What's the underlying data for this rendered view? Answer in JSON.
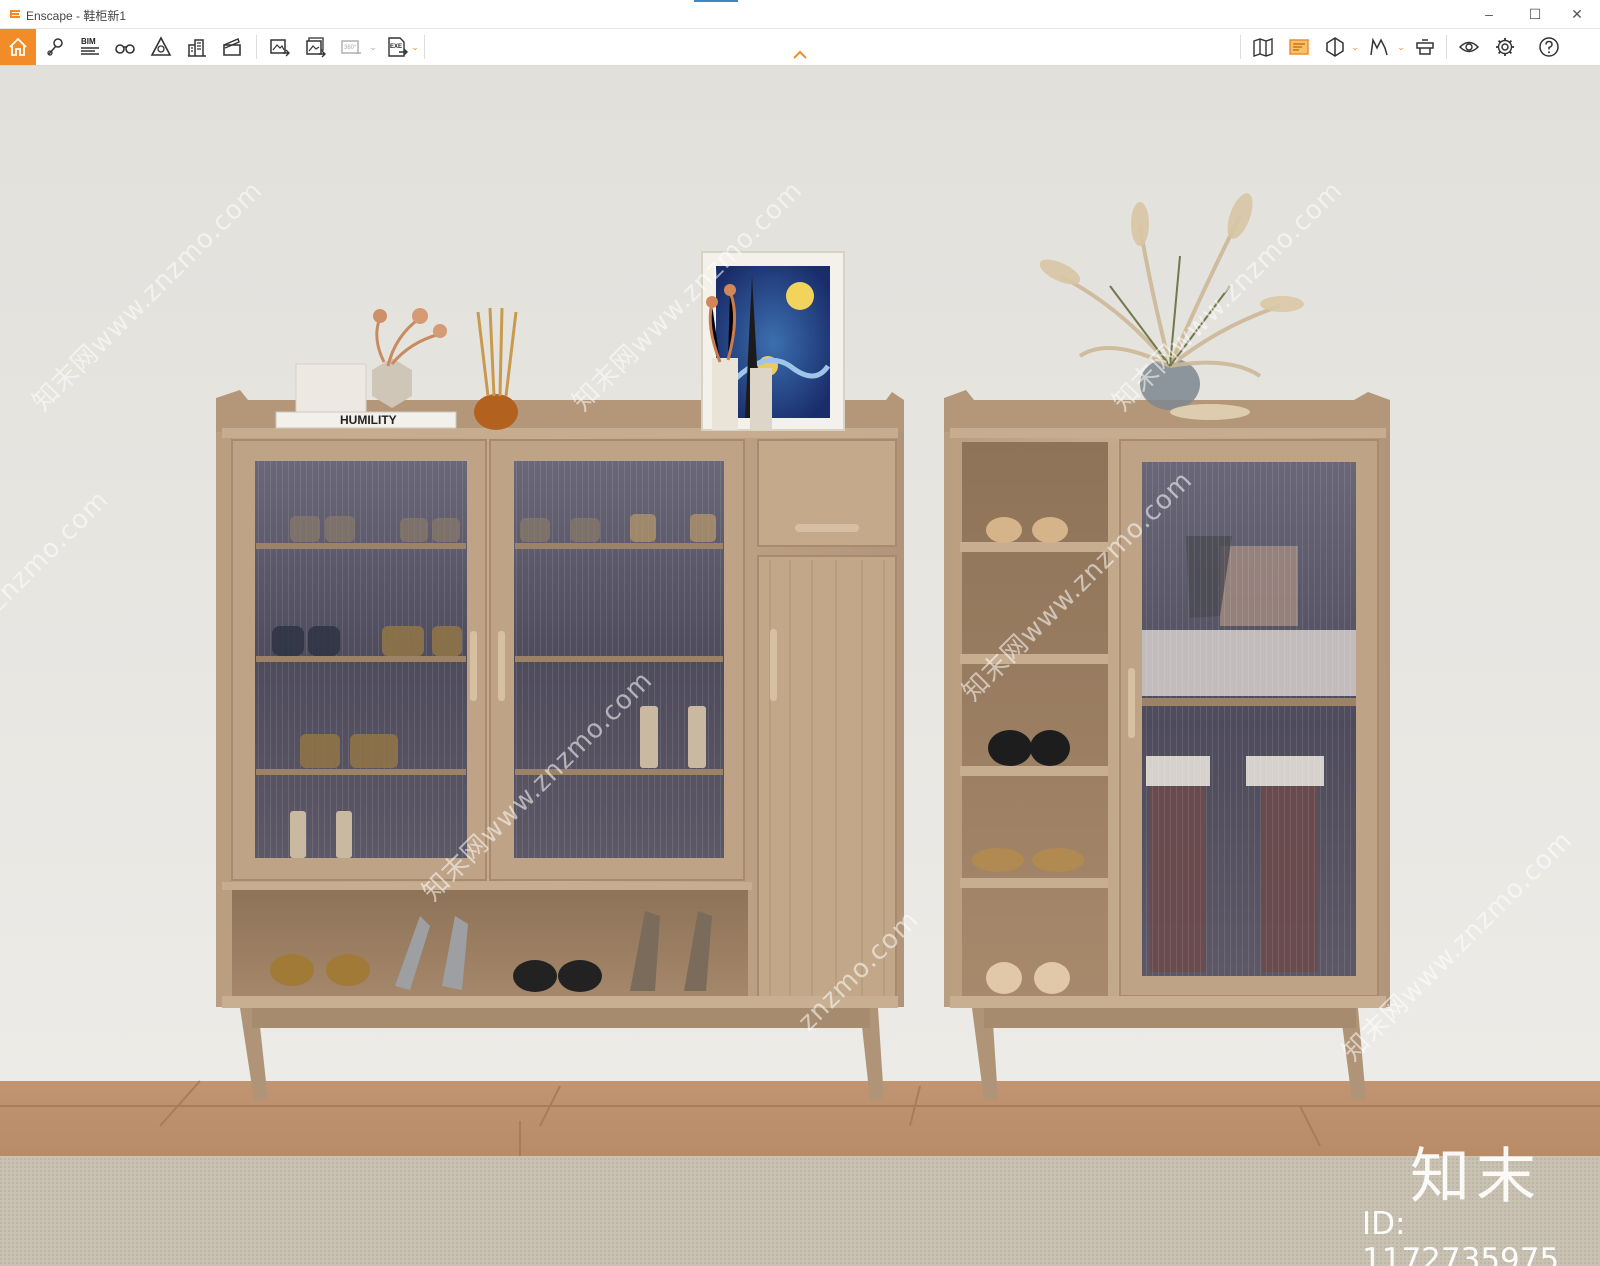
{
  "window": {
    "app_name": "Enscape",
    "title": "Enscape - 鞋柜新1",
    "min_label": "–",
    "max_label": "☐",
    "close_label": "✕"
  },
  "toolbar": {
    "home_icon": "home-icon",
    "bim_label": "BIM",
    "panorama_label": "360°",
    "exe_label": "EXE",
    "accent_color": "#f28c28"
  },
  "viewport": {
    "book_label": "HUMILITY",
    "watermark_text": "知末网www.znzmo.com",
    "watermark_short": "znzmo.com",
    "logo_text": "知末",
    "id_text": "ID: 1172735975"
  }
}
